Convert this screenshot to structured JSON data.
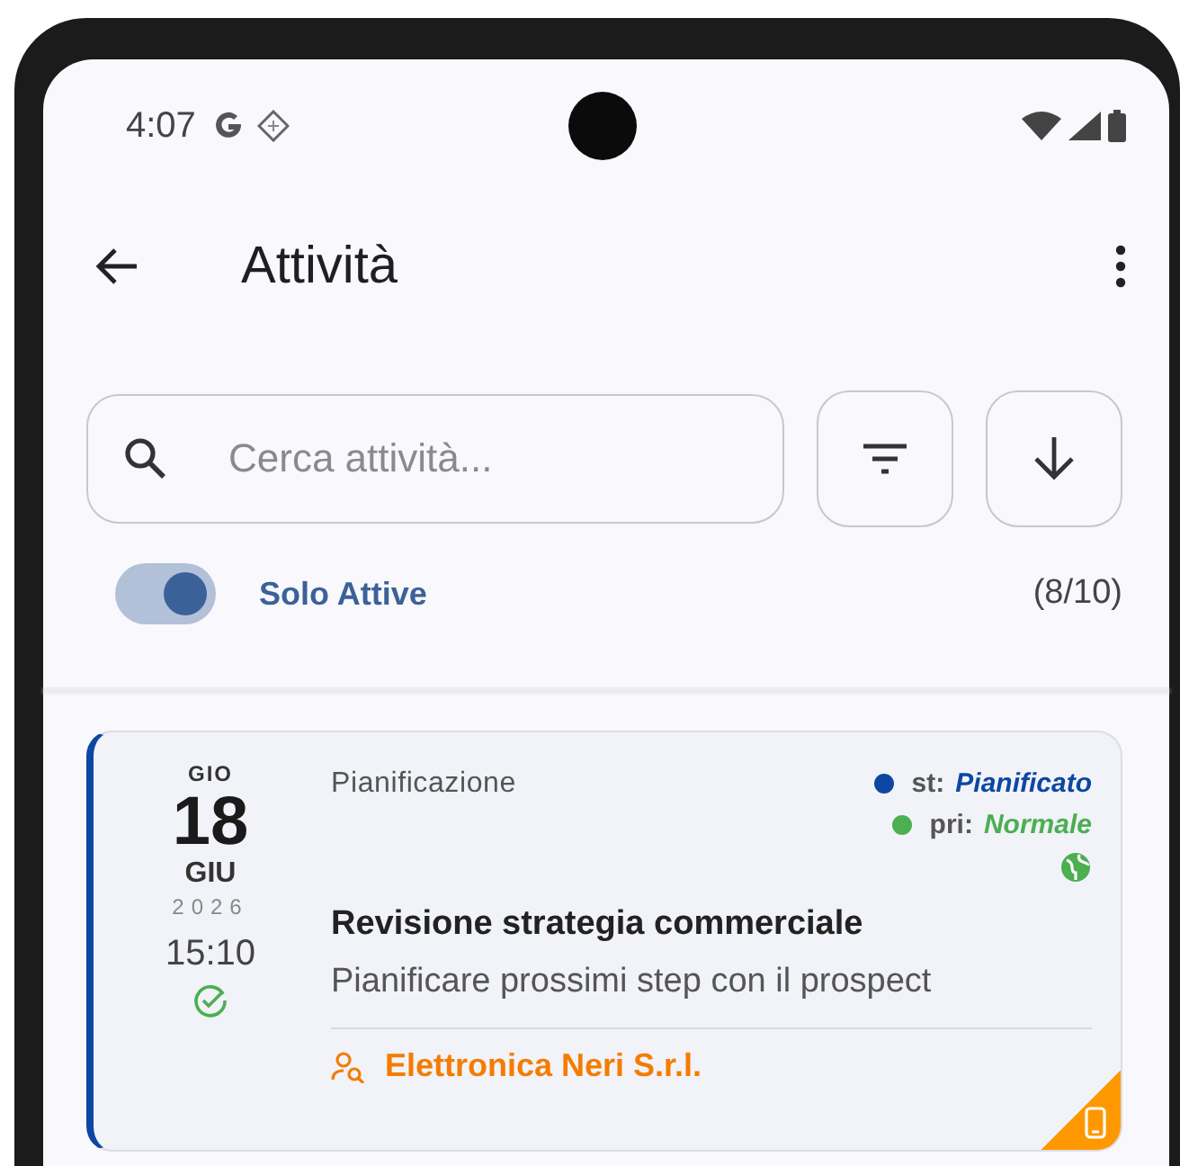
{
  "status_bar": {
    "time": "4:07"
  },
  "app_bar": {
    "title": "Attività"
  },
  "search": {
    "placeholder": "Cerca attività..."
  },
  "filter": {
    "label": "Solo Attive",
    "on": true,
    "count": "(8/10)"
  },
  "activities": [
    {
      "weekday": "GIO",
      "day": "18",
      "month": "GIU",
      "year": "2026",
      "time": "15:10",
      "completed": true,
      "category": "Pianificazione",
      "tags": [
        {
          "label": "st:",
          "value": "Pianificato",
          "color": "#0d47a1"
        },
        {
          "label": "pri:",
          "value": "Normale",
          "color": "#4caf50"
        }
      ],
      "title": "Revisione strategia commerciale",
      "description": "Pianificare prossimi step con il prospect",
      "company": "Elettronica Neri S.r.l.",
      "mobile": true
    }
  ]
}
